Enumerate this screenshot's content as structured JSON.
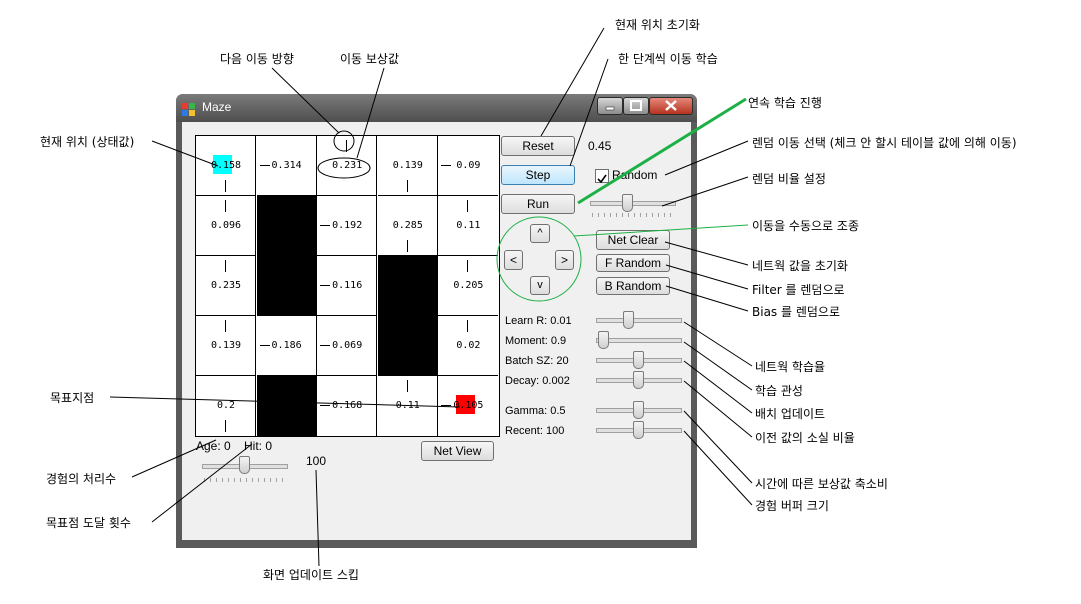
{
  "window": {
    "title": "Maze"
  },
  "grid": {
    "values": [
      [
        "0.158",
        "0.314",
        "0.231",
        "0.139",
        "0.09"
      ],
      [
        "0.096",
        "",
        "0.192",
        "0.285",
        "0.11"
      ],
      [
        "0.235",
        "",
        "0.116",
        "",
        "0.205"
      ],
      [
        "0.139",
        "0.186",
        "0.069",
        "",
        "0.02"
      ],
      [
        "0.2",
        "",
        "0.168",
        "0.11",
        "0.105"
      ]
    ],
    "walls": [
      [
        1,
        1
      ],
      [
        2,
        1
      ],
      [
        4,
        1
      ],
      [
        2,
        3
      ],
      [
        3,
        3
      ]
    ],
    "agent_color": "#00ffff",
    "goal_color": "#ff0000"
  },
  "status": {
    "age": "Age: 0",
    "hit": "Hit: 0",
    "skip_value": "100"
  },
  "buttons": {
    "reset": "Reset",
    "step": "Step",
    "run": "Run",
    "net_view": "Net View",
    "net_clear": "Net Clear",
    "f_random": "F Random",
    "b_random": "B Random",
    "up": "^",
    "left": "<",
    "right": ">",
    "down": "v"
  },
  "random": {
    "value": "0.45",
    "label": "Random",
    "checked": true
  },
  "params": {
    "learn_rate": "Learn R: 0.01",
    "moment": "Moment: 0.9",
    "batch": "Batch SZ: 20",
    "decay": "Decay: 0.002",
    "gamma": "Gamma: 0.5",
    "recent": "Recent: 100"
  },
  "annotations": {
    "next_direction": "다음 이동 방향",
    "move_reward": "이동 보상값",
    "current_position": "현재 위치 (상태값)",
    "goal": "목표지점",
    "experience_count": "경험의 처리수",
    "goal_reached_count": "목표점 도달 횟수",
    "screen_skip": "화면 업데이트 스킵",
    "reset_position": "현재 위치 초기화",
    "step_learning": "한 단계씩 이동 학습",
    "continuous_learning": "연속 학습 진행",
    "random_move": "렌덤 이동 선택 (체크 안 할시 테이블 값에 의해 이동)",
    "random_ratio": "렌덤 비율 설정",
    "manual_move": "이동을 수동으로 조종",
    "net_init": "네트웍 값을 초기화",
    "filter_random": "Filter 를 렌덤으로",
    "bias_random": "Bias 를 렌덤으로",
    "learning_rate": "네트웍 학습율",
    "inertia": "학습 관성",
    "batch_update": "배치 업데이트",
    "decay_ratio": "이전 값의 소실 비율",
    "reward_discount": "시간에 따른 보상값 축소비",
    "buffer_size": "경험 버퍼 크기"
  }
}
